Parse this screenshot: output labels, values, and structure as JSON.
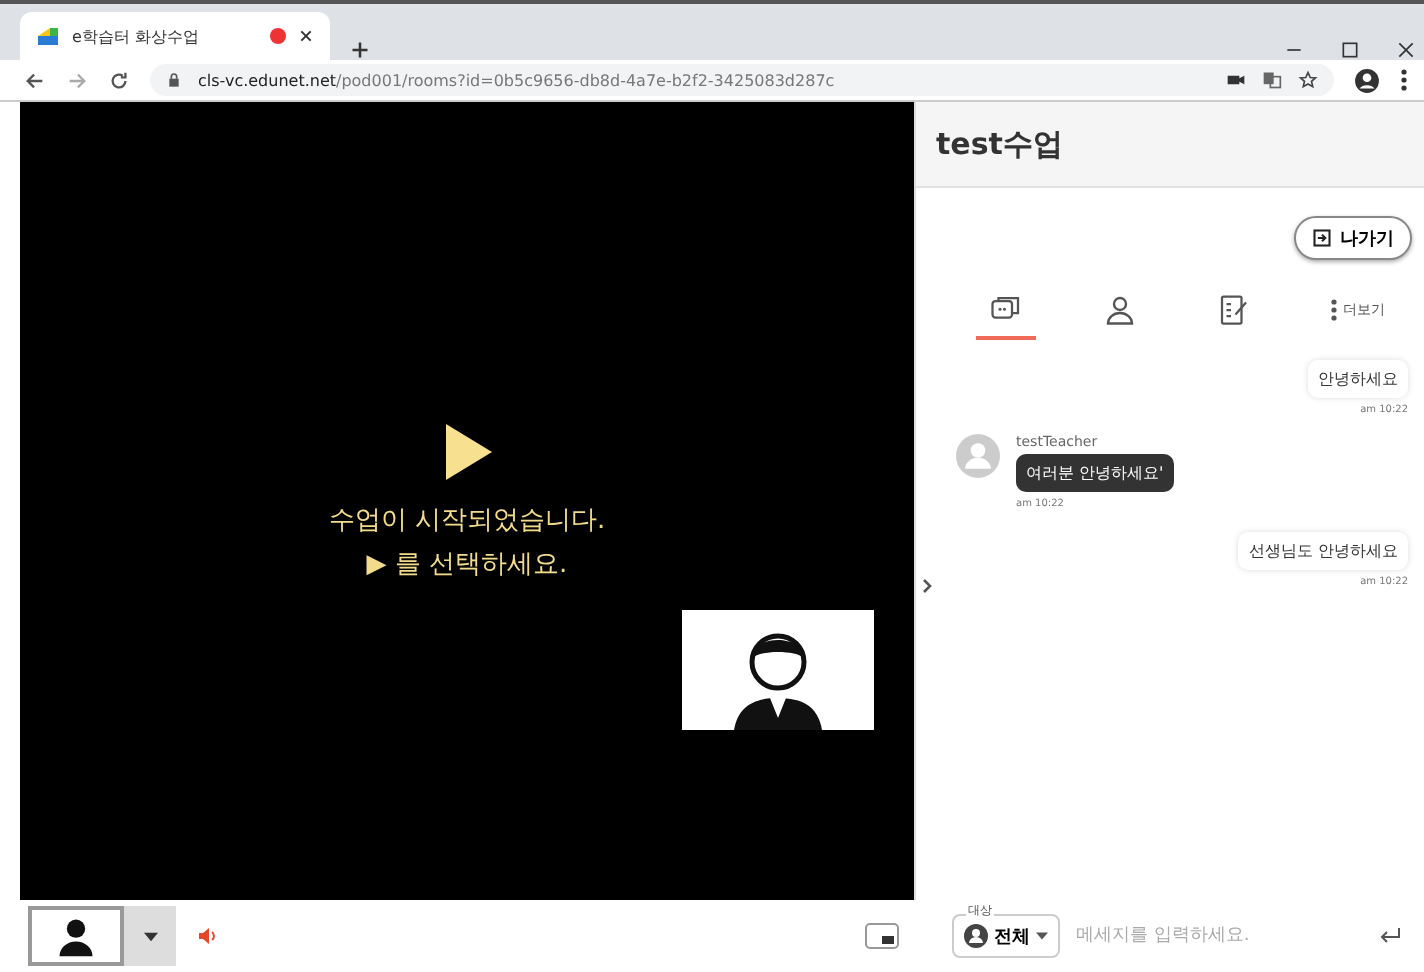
{
  "browser": {
    "tab_title": "e학습터 화상수업",
    "recording": true,
    "url_host": "cls-vc.edunet.net",
    "url_path": "/pod001/rooms?id=0b5c9656-db8d-4a7e-b2f2-3425083d287c"
  },
  "video": {
    "lines": [
      "수업이 시작되었습니다.",
      "▶ 를 선택하세요."
    ]
  },
  "panel": {
    "title": "test수업",
    "exit_button": "나가기",
    "tabs": [
      {
        "kind": "chat",
        "selected": true
      },
      {
        "kind": "people",
        "selected": false
      },
      {
        "kind": "notes",
        "selected": false
      },
      {
        "kind": "more",
        "label": "더보기",
        "selected": false
      }
    ],
    "messages": [
      {
        "kind": "mine",
        "text": "안녕하세요",
        "time": "am 10:22"
      },
      {
        "kind": "other",
        "sender": "testTeacher",
        "text": "여러분 안녕하세요'",
        "time": "am 10:22"
      },
      {
        "kind": "mine",
        "text": "선생님도 안녕하세요",
        "time": "am 10:22"
      }
    ]
  },
  "composer": {
    "target_label": "대상",
    "target": "전체",
    "placeholder": "메세지를 입력하세요."
  }
}
